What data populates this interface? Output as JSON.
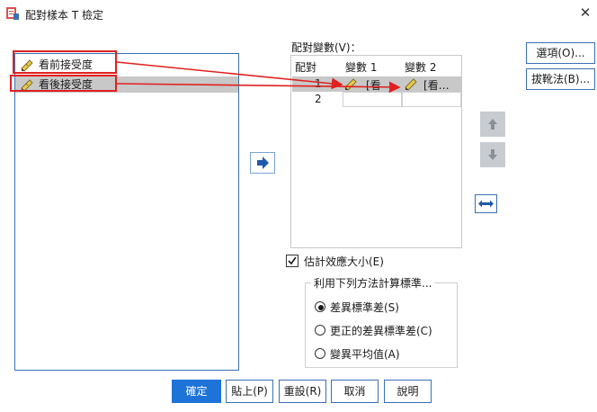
{
  "window": {
    "title": "配對樣本 T 檢定",
    "close_glyph": "✕"
  },
  "variables": [
    {
      "label": "看前接受度",
      "selected": false
    },
    {
      "label": "看後接受度",
      "selected": true
    }
  ],
  "pairs": {
    "label": "配對變數(V)：",
    "columns": [
      "配對",
      "變數 1",
      "變數 2"
    ],
    "rows": [
      {
        "pair": "1",
        "var1": "[看",
        "var2": "[看…"
      },
      {
        "pair": "2",
        "var1": "",
        "var2": ""
      }
    ]
  },
  "side_buttons": {
    "options": "選項(O)...",
    "bootstrap": "拔靴法(B)..."
  },
  "effect_size": {
    "label": "估計效應大小(E)",
    "checked": true
  },
  "std_group": {
    "title": "利用下列方法計算標準...",
    "options": [
      {
        "label": "差異標準差(S)",
        "selected": true
      },
      {
        "label": "更正的差異標準差(C)",
        "selected": false
      },
      {
        "label": "變異平均值(A)",
        "selected": false
      }
    ]
  },
  "buttons": {
    "ok": "確定",
    "paste": "貼上(P)",
    "reset": "重設(R)",
    "cancel": "取消",
    "help": "說明"
  },
  "colors": {
    "accent": "#1e73d8",
    "annotation": "#e02020",
    "selection": "#c8c8c8"
  },
  "icons": [
    "app-icon",
    "close-icon",
    "ruler-pencil-icon",
    "move-right-arrow-icon",
    "arrow-up-icon",
    "arrow-down-icon",
    "swap-icon"
  ]
}
